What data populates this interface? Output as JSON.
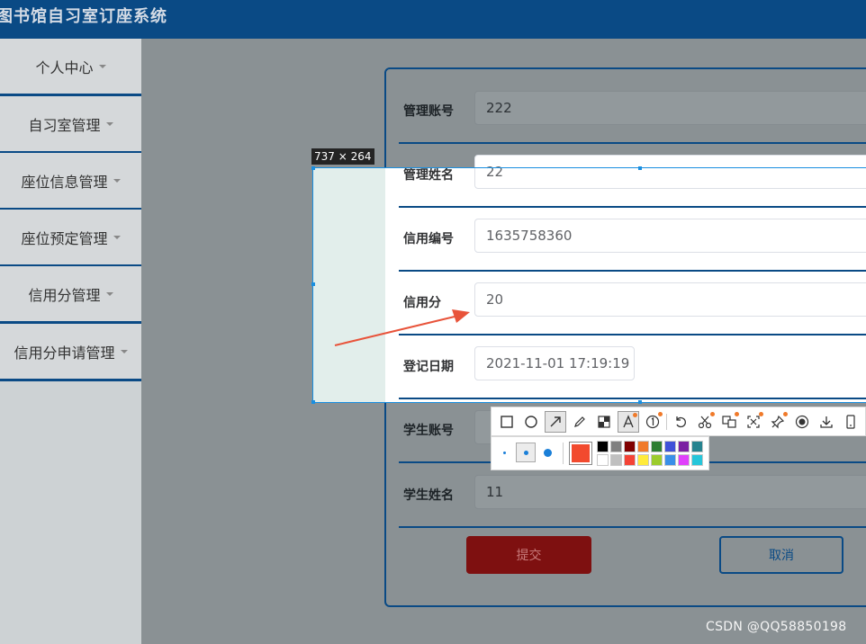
{
  "app": {
    "title": "图书馆自习室订座系统"
  },
  "sidebar": {
    "items": [
      {
        "label": "个人中心"
      },
      {
        "label": "自习室管理"
      },
      {
        "label": "座位信息管理"
      },
      {
        "label": "座位预定管理"
      },
      {
        "label": "信用分管理"
      },
      {
        "label": "信用分申请管理"
      }
    ]
  },
  "form": {
    "fields": [
      {
        "label": "管理账号",
        "value": "222"
      },
      {
        "label": "管理姓名",
        "value": "22"
      },
      {
        "label": "信用编号",
        "value": "1635758360"
      },
      {
        "label": "信用分",
        "value": "20"
      },
      {
        "label": "登记日期",
        "value": "2021-11-01 17:19:19"
      },
      {
        "label": "学生账号",
        "value": ""
      },
      {
        "label": "学生姓名",
        "value": "11"
      }
    ],
    "submit_label": "提交",
    "cancel_label": "取消"
  },
  "screenshot_tool": {
    "size_label": "737 × 264",
    "tools": [
      "rectangle-icon",
      "ellipse-icon",
      "arrow-icon",
      "pencil-icon",
      "mosaic-icon",
      "text-icon",
      "number-icon",
      "undo-icon",
      "cut-icon",
      "translate-icon",
      "ocr-icon",
      "pin-icon",
      "record-icon",
      "save-icon",
      "phone-icon"
    ],
    "active_tool": "arrow-icon",
    "pen_sizes": [
      "small",
      "medium",
      "large"
    ],
    "active_pen_size": "medium",
    "current_color": "#f24a2e",
    "palette": [
      "#000000",
      "#808080",
      "#800000",
      "#f07a2a",
      "#2e7d32",
      "#3f51d8",
      "#7b1fa2",
      "#26838f",
      "#ffffff",
      "#c0c0c0",
      "#f44336",
      "#ffeb3b",
      "#9ccc2c",
      "#3a8fe8",
      "#e040fb",
      "#26c6da"
    ],
    "arrow_color": "#e8533a"
  },
  "watermark": "CSDN @QQ58850198"
}
